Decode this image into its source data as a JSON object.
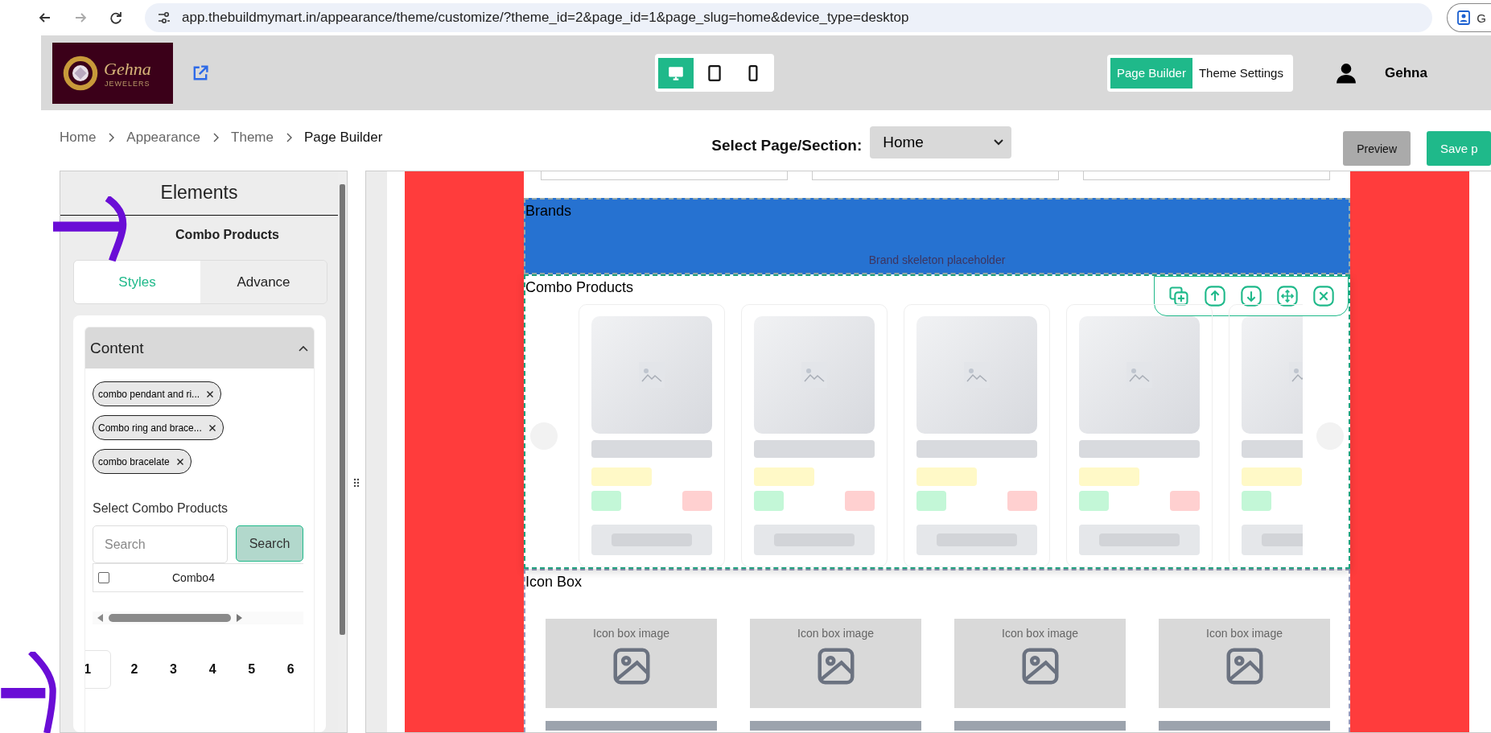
{
  "browser": {
    "url": "app.thebuildmymart.in/appearance/theme/customize/?theme_id=2&page_id=1&page_slug=home&device_type=desktop",
    "profile_label": "G"
  },
  "header": {
    "logo_name": "Gehna",
    "logo_sub": "JEWELERS",
    "devices": [
      {
        "kind": "desktop",
        "selected": true
      },
      {
        "kind": "tablet",
        "selected": false
      },
      {
        "kind": "mobile",
        "selected": false
      }
    ],
    "mode_tabs": [
      {
        "label": "Page Builder",
        "selected": true
      },
      {
        "label": "Theme Settings",
        "selected": false
      }
    ],
    "user_name": "Gehna"
  },
  "breadcrumb": [
    "Home",
    "Appearance",
    "Theme",
    "Page Builder"
  ],
  "page_select": {
    "label": "Select Page/Section:",
    "value": "Home"
  },
  "actions": [
    {
      "label": "Preview",
      "kind": "secondary"
    },
    {
      "label": "Save p",
      "kind": "primary"
    }
  ],
  "sidebar": {
    "title": "Elements",
    "element_name": "Combo Products",
    "tabs": [
      {
        "label": "Styles",
        "selected": true
      },
      {
        "label": "Advance",
        "selected": false
      }
    ],
    "section": {
      "title": "Content",
      "expanded": true
    },
    "chips": [
      "combo pendant and ri...",
      "Combo ring and brace...",
      "combo bracelate"
    ],
    "select_label": "Select Combo Products",
    "search": {
      "placeholder": "Search",
      "button": "Search"
    },
    "results": [
      {
        "name": "Combo4",
        "checked": false
      }
    ],
    "pages": [
      {
        "label": "1",
        "selected": true
      },
      {
        "label": "2",
        "selected": false
      },
      {
        "label": "3",
        "selected": false
      },
      {
        "label": "4",
        "selected": false
      },
      {
        "label": "5",
        "selected": false
      },
      {
        "label": "6",
        "selected": false
      }
    ]
  },
  "canvas": {
    "brands": {
      "title": "Brands",
      "placeholder": "Brand skeleton placeholder"
    },
    "combo": {
      "title": "Combo Products",
      "selected": true,
      "cards": [
        {
          "kind": "skeleton"
        },
        {
          "kind": "skeleton"
        },
        {
          "kind": "skeleton"
        },
        {
          "kind": "skeleton"
        },
        {
          "kind": "skeleton_cut"
        }
      ]
    },
    "icon_box": {
      "title": "Icon Box",
      "items": [
        {
          "label": "Icon box image"
        },
        {
          "label": "Icon box image"
        },
        {
          "label": "Icon box image"
        },
        {
          "label": "Icon box image"
        }
      ]
    }
  }
}
